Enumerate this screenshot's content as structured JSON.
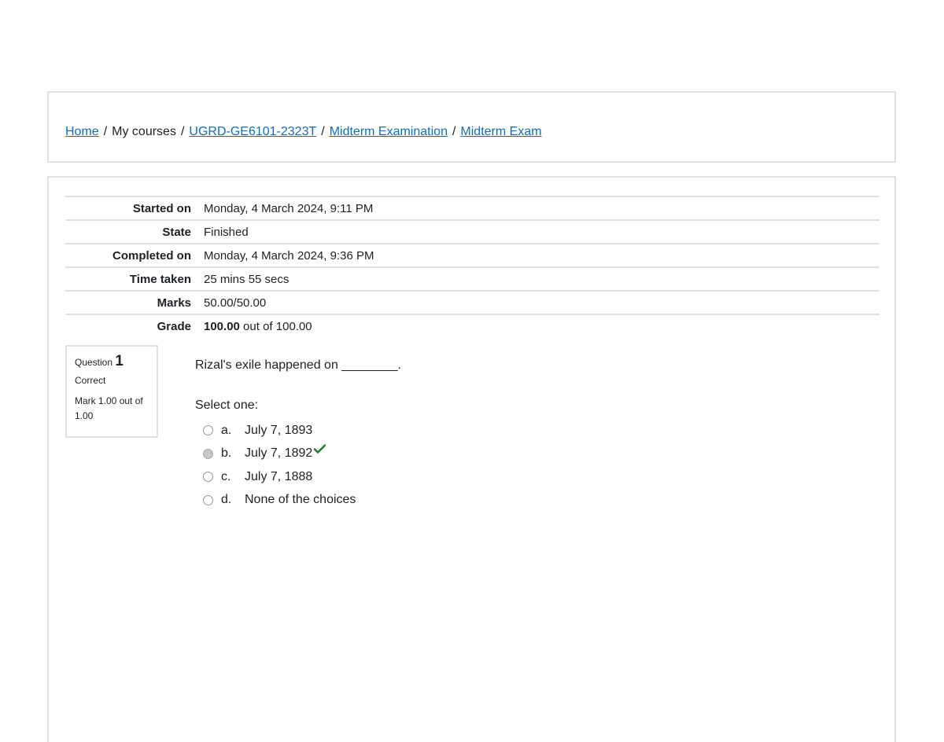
{
  "breadcrumb": {
    "home": "Home",
    "my_courses": "My courses",
    "course": "UGRD-GE6101-2323T",
    "section": "Midterm Examination",
    "quiz": "Midterm Exam",
    "separator": "/"
  },
  "summary": [
    {
      "label": "Started on",
      "value": "Monday, 4 March 2024, 9:11 PM"
    },
    {
      "label": "State",
      "value": "Finished"
    },
    {
      "label": "Completed on",
      "value": "Monday, 4 March 2024, 9:36 PM"
    },
    {
      "label": "Time taken",
      "value": "25 mins 55 secs"
    },
    {
      "label": "Marks",
      "value": "50.00/50.00"
    },
    {
      "label": "Grade",
      "value_bold": "100.00",
      "value_rest": " out of 100.00"
    }
  ],
  "question": {
    "label": "Question",
    "number": "1",
    "state": "Correct",
    "mark": "Mark 1.00 out of 1.00",
    "text": "Rizal's exile happened on ________.",
    "prompt": "Select one:",
    "options": [
      {
        "letter": "a.",
        "text": "July 7, 1893",
        "checked": false,
        "correct": false
      },
      {
        "letter": "b.",
        "text": "July 7, 1892",
        "checked": true,
        "correct": true
      },
      {
        "letter": "c.",
        "text": "July 7, 1888",
        "checked": false,
        "correct": false
      },
      {
        "letter": "d.",
        "text": "None of the choices",
        "checked": false,
        "correct": false
      }
    ],
    "correct_icon": "check-icon"
  },
  "colors": {
    "link": "#0f6cbf",
    "correct": "#357a32",
    "border": "#dee2e6"
  }
}
